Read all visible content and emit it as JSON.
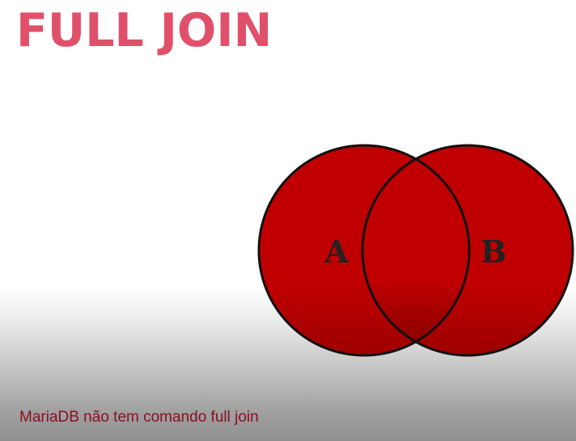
{
  "slide": {
    "title": "FULL JOIN",
    "caption": "MariaDB não tem comando full join"
  },
  "diagram": {
    "set_a_label": "A",
    "set_b_label": "B",
    "fill_color": "#c00000",
    "outline_color": "#111111"
  },
  "colors": {
    "title": "#e0506a",
    "caption": "#8a1020"
  }
}
